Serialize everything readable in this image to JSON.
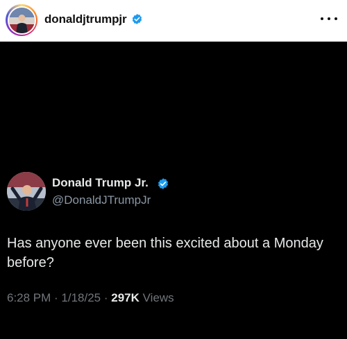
{
  "header": {
    "username": "donaldjtrumpjr",
    "verified_icon": "verified-badge-icon",
    "more_icon": "more-horizontal-icon",
    "avatar": "profile-avatar"
  },
  "tweet": {
    "display_name": "Donald Trump Jr.",
    "handle": "@DonaldJTrumpJr",
    "text": "Has anyone ever been this excited about a Monday before?",
    "time": "6:28 PM",
    "separator": " · ",
    "date": "1/18/25",
    "views_count": "297K",
    "views_label": "Views"
  },
  "colors": {
    "background": "#000000",
    "header_bg": "#ffffff",
    "verified_blue": "#1d9bf0",
    "text_primary": "#e7e9ea",
    "text_secondary": "#71767b"
  }
}
